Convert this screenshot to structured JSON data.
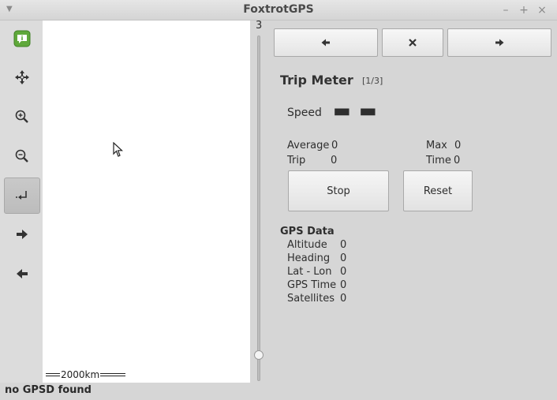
{
  "window": {
    "title": "FoxtrotGPS",
    "menu_icon": "chevron-down-icon",
    "controls": [
      "minimize-icon",
      "maximize-icon",
      "close-icon"
    ]
  },
  "toolbar": {
    "items": [
      {
        "name": "info-icon",
        "active": false
      },
      {
        "name": "move-icon",
        "active": false
      },
      {
        "name": "zoom-in-icon",
        "active": false
      },
      {
        "name": "zoom-out-icon",
        "active": false
      },
      {
        "name": "autocenter-icon",
        "active": true
      },
      {
        "name": "arrow-right-icon",
        "active": false
      },
      {
        "name": "arrow-left-icon",
        "active": false
      }
    ]
  },
  "map": {
    "scale_label": "2000km",
    "zoom_level": "3"
  },
  "trip_meter": {
    "title": "Trip Meter",
    "count": "[1/3]",
    "speed_label": "Speed",
    "speed_value": "▬ ▬",
    "average_label": "Average",
    "average_value": "0",
    "max_label": "Max",
    "max_value": "0",
    "trip_label": "Trip",
    "trip_value": "0",
    "time_label": "Time",
    "time_value": "0",
    "stop_label": "Stop",
    "reset_label": "Reset"
  },
  "gps_data": {
    "title": "GPS Data",
    "rows": [
      {
        "label": "Altitude",
        "value": "0"
      },
      {
        "label": "Heading",
        "value": "0"
      },
      {
        "label": "Lat - Lon",
        "value": "0"
      },
      {
        "label": "GPS Time",
        "value": "0"
      },
      {
        "label": "Satellites",
        "value": "0"
      }
    ]
  },
  "status": {
    "text": "no GPSD found"
  }
}
